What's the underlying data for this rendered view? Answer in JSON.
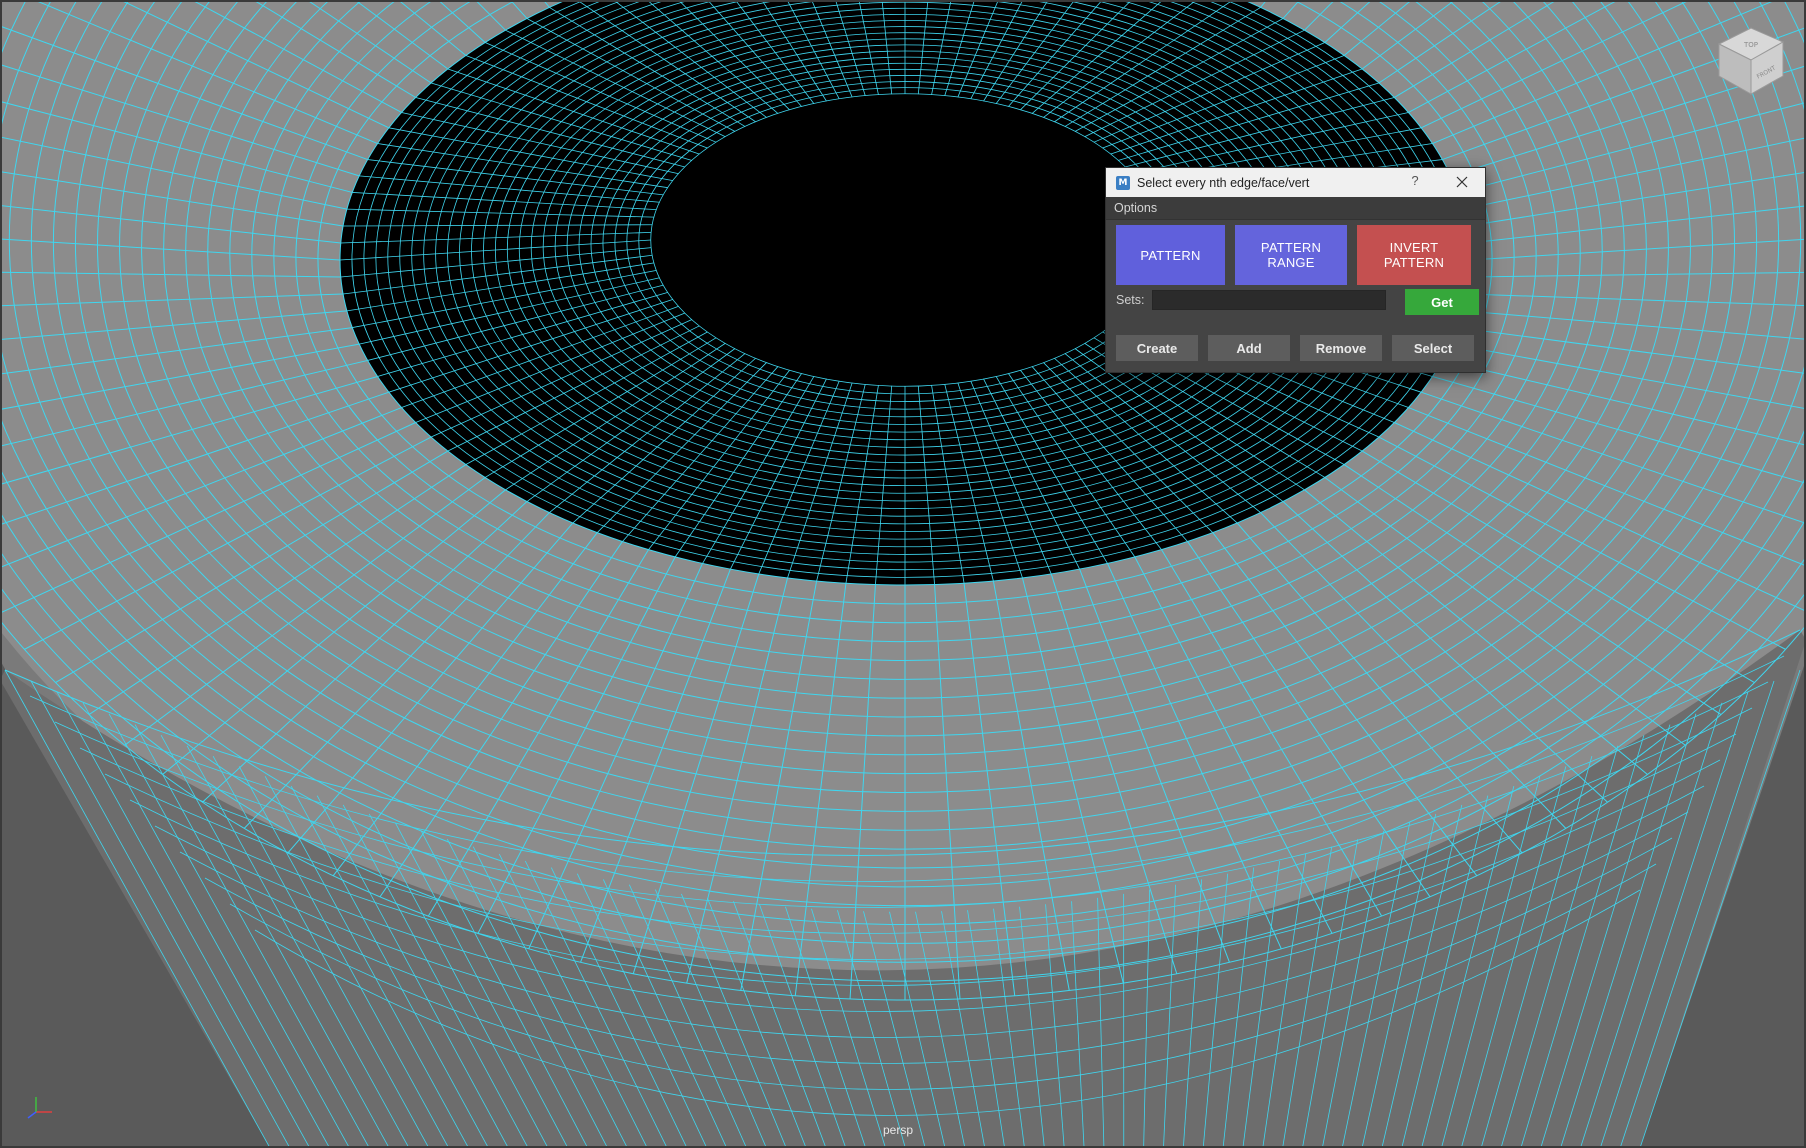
{
  "viewport": {
    "camera_label": "persp",
    "viewcube": {
      "top_label": "TOP",
      "front_label": "FRONT"
    },
    "mesh_wire_color": "#3fd6ef",
    "mesh_face_color": "#8c8c8c"
  },
  "dialog": {
    "title": "Select every nth edge/face/vert",
    "help_label": "?",
    "menu": [
      "Options"
    ],
    "buttons": {
      "pattern": "PATTERN",
      "pattern_range": "PATTERN RANGE",
      "invert_pattern": "INVERT PATTERN"
    },
    "colors": {
      "pattern": "#6060dc",
      "invert": "#c45050",
      "get": "#36a83b"
    },
    "sets": {
      "label": "Sets:",
      "value": "",
      "get_label": "Get"
    },
    "actions": {
      "create": "Create",
      "add": "Add",
      "remove": "Remove",
      "select": "Select"
    }
  }
}
